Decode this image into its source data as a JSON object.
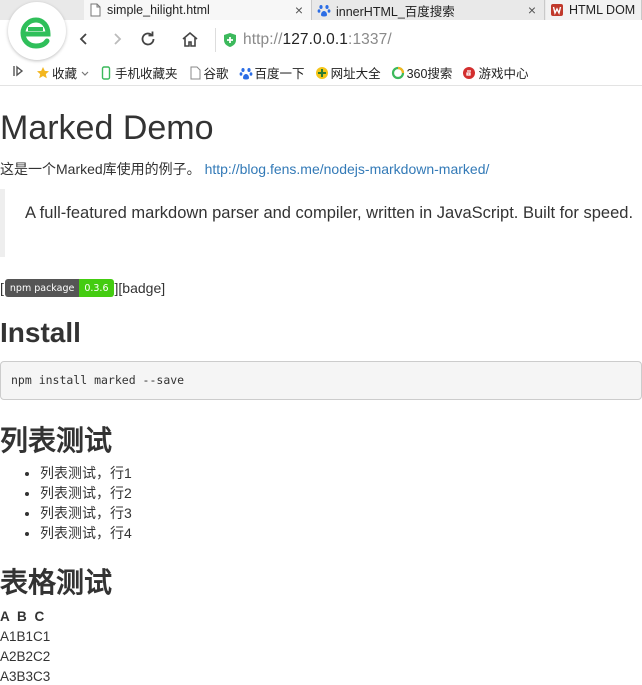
{
  "browser": {
    "tabs": [
      {
        "title": "simple_hilight.html",
        "close": "×"
      },
      {
        "title": "innerHTML_百度搜索",
        "close": "×"
      },
      {
        "title": "HTML DOM"
      }
    ],
    "address": {
      "protocol": "http://",
      "host": "127.0.0.1",
      "rest": ":1337/"
    },
    "bookmarks": [
      "收藏",
      "手机收藏夹",
      "谷歌",
      "百度一下",
      "网址大全",
      "360搜索",
      "游戏中心"
    ]
  },
  "page": {
    "title": "Marked Demo",
    "intro_text": "这是一个Marked库使用的例子。",
    "intro_link": "http://blog.fens.me/nodejs-markdown-marked/",
    "blockquote": "A full-featured markdown parser and compiler, written in JavaScript. Built for speed.",
    "badge": {
      "label": "npm package",
      "version": "0.3.6",
      "open": "[",
      "suffix": "][badge]"
    },
    "install_heading": "Install",
    "install_code": "npm install marked --save",
    "list_heading": "列表测试",
    "list_items": [
      "列表测试，行1",
      "列表测试，行2",
      "列表测试，行3",
      "列表测试，行4"
    ],
    "table_heading": "表格测试",
    "table": {
      "header": "A B C",
      "rows": [
        "A1B1C1",
        "A2B2C2",
        "A3B3C3"
      ]
    }
  }
}
